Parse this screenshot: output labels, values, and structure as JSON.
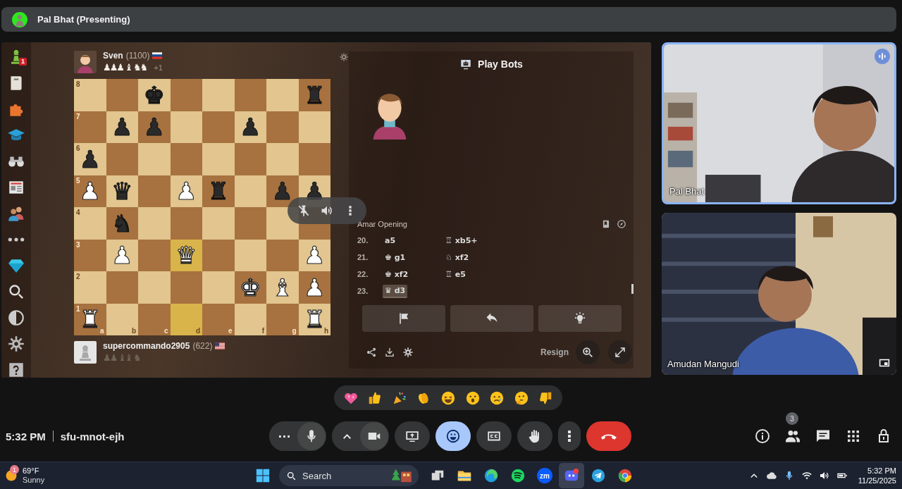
{
  "presenter_bar": {
    "name": "Pal Bhat (Presenting)"
  },
  "chess": {
    "play_badge": "1",
    "top_player": {
      "name": "Sven",
      "rating": "(1100)",
      "captured": "♟♟♟ ♝ ♞♞",
      "advantage": "+1"
    },
    "bottom_player": {
      "name": "supercommando2905",
      "rating": "(622)",
      "captured": "♟♟ ♝♝ ♞"
    },
    "files": [
      "a",
      "b",
      "c",
      "d",
      "e",
      "f",
      "g",
      "h"
    ],
    "ranks": [
      {
        "label": "8",
        "squares": [
          {
            "highlight": false
          },
          {
            "highlight": false
          },
          {
            "highlight": false,
            "piece": "♚",
            "white": false
          },
          {
            "highlight": false
          },
          {
            "highlight": false
          },
          {
            "highlight": false
          },
          {
            "highlight": false
          },
          {
            "highlight": false,
            "piece": "♜",
            "white": false
          }
        ]
      },
      {
        "label": "7",
        "squares": [
          {
            "highlight": false
          },
          {
            "highlight": false,
            "piece": "♟",
            "white": false
          },
          {
            "highlight": false,
            "piece": "♟",
            "white": false
          },
          {
            "highlight": false
          },
          {
            "highlight": false
          },
          {
            "highlight": false,
            "piece": "♟",
            "white": false
          },
          {
            "highlight": false
          },
          {
            "highlight": false
          }
        ]
      },
      {
        "label": "6",
        "squares": [
          {
            "highlight": false,
            "piece": "♟",
            "white": false
          },
          {
            "highlight": false
          },
          {
            "highlight": false
          },
          {
            "highlight": false
          },
          {
            "highlight": false
          },
          {
            "highlight": false
          },
          {
            "highlight": false
          },
          {
            "highlight": false
          }
        ]
      },
      {
        "label": "5",
        "squares": [
          {
            "highlight": false,
            "piece": "♟",
            "white": true
          },
          {
            "highlight": false,
            "piece": "♛",
            "white": false
          },
          {
            "highlight": false
          },
          {
            "highlight": false,
            "piece": "♟",
            "white": true
          },
          {
            "highlight": false,
            "piece": "♜",
            "white": false
          },
          {
            "highlight": false
          },
          {
            "highlight": false,
            "piece": "♟",
            "white": false
          },
          {
            "highlight": false,
            "piece": "♟",
            "white": false
          }
        ]
      },
      {
        "label": "4",
        "squares": [
          {
            "highlight": false
          },
          {
            "highlight": false,
            "piece": "♞",
            "white": false
          },
          {
            "highlight": false
          },
          {
            "highlight": false
          },
          {
            "highlight": false
          },
          {
            "highlight": false
          },
          {
            "highlight": false
          },
          {
            "highlight": false
          }
        ]
      },
      {
        "label": "3",
        "squares": [
          {
            "highlight": false
          },
          {
            "highlight": false,
            "piece": "♟",
            "white": true
          },
          {
            "highlight": false
          },
          {
            "highlight": true,
            "piece": "♛",
            "white": true
          },
          {
            "highlight": false
          },
          {
            "highlight": false
          },
          {
            "highlight": false
          },
          {
            "highlight": false,
            "piece": "♟",
            "white": true
          }
        ]
      },
      {
        "label": "2",
        "squares": [
          {
            "highlight": false
          },
          {
            "highlight": false
          },
          {
            "highlight": false
          },
          {
            "highlight": false
          },
          {
            "highlight": false
          },
          {
            "highlight": false,
            "piece": "♚",
            "white": true
          },
          {
            "highlight": false,
            "piece": "♝",
            "white": true
          },
          {
            "highlight": false,
            "piece": "♟",
            "white": true
          }
        ]
      },
      {
        "label": "1",
        "squares": [
          {
            "highlight": false,
            "piece": "♜",
            "white": true
          },
          {
            "highlight": false
          },
          {
            "highlight": false
          },
          {
            "highlight": true
          },
          {
            "highlight": false
          },
          {
            "highlight": false
          },
          {
            "highlight": false
          },
          {
            "highlight": false,
            "piece": "♜",
            "white": true
          }
        ]
      }
    ],
    "panel": {
      "title": "Play Bots",
      "opening": "Amar Opening",
      "moves": [
        {
          "number": "20.",
          "white": {
            "text": "a5",
            "selected": false
          },
          "black": {
            "text": "♖ xb5+",
            "selected": false
          }
        },
        {
          "number": "21.",
          "white": {
            "text": "♚ g1",
            "selected": false
          },
          "black": {
            "text": "♘ xf2",
            "selected": false
          }
        },
        {
          "number": "22.",
          "white": {
            "text": "♚ xf2",
            "selected": false
          },
          "black": {
            "text": "♖ e5",
            "selected": false
          }
        },
        {
          "number": "23.",
          "white": {
            "text": "♛ d3",
            "selected": true
          }
        }
      ],
      "resign": "Resign"
    }
  },
  "tiles": [
    {
      "name": "Pal Bhat",
      "speaking": true
    },
    {
      "name": "Amudan Mangudi",
      "speaking": false
    }
  ],
  "meeting": {
    "time": "5:32 PM",
    "code": "sfu-mnot-ejh"
  },
  "controls": [
    {
      "kind": "mic",
      "selected": false
    },
    {
      "kind": "camera",
      "selected": false
    },
    {
      "kind": "present",
      "selected": false
    },
    {
      "kind": "reactions",
      "selected": true
    },
    {
      "kind": "captions",
      "selected": false
    },
    {
      "kind": "hand",
      "selected": false
    },
    {
      "kind": "more",
      "selected": false
    },
    {
      "kind": "leave",
      "selected": false
    }
  ],
  "people_count": "3",
  "taskbar": {
    "weather_badge": "1",
    "temperature": "69°F",
    "condition": "Sunny",
    "search_label": "Search",
    "zoom_label": "zm",
    "time": "5:32 PM",
    "date": "11/25/2025"
  }
}
